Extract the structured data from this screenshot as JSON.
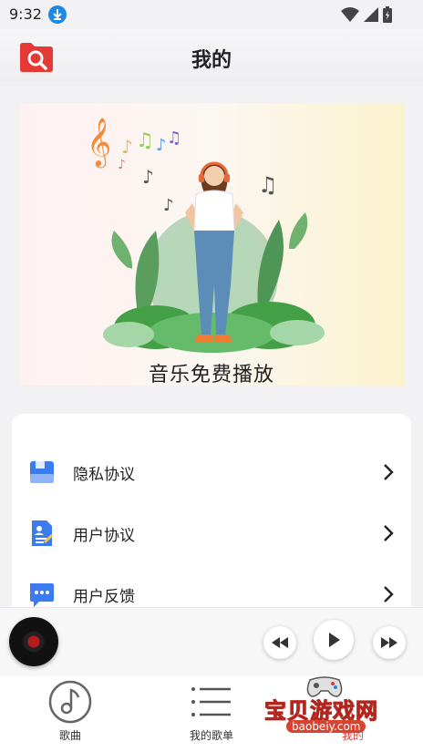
{
  "status_bar": {
    "time": "9:32"
  },
  "header": {
    "title": "我的"
  },
  "banner": {
    "caption": "音乐免费播放"
  },
  "menu": [
    {
      "label": "隐私协议",
      "icon": "privacy-icon"
    },
    {
      "label": "用户协议",
      "icon": "agreement-document-icon"
    },
    {
      "label": "用户反馈",
      "icon": "feedback-chat-icon"
    }
  ],
  "tabs": [
    {
      "label": "歌曲",
      "icon": "music-note-icon"
    },
    {
      "label": "我的歌单",
      "icon": "playlist-icon"
    },
    {
      "label": "我的",
      "icon": "profile-icon"
    }
  ],
  "watermark": {
    "text": "宝贝游戏网",
    "url": "baobeiy.com"
  },
  "colors": {
    "accent": "#e53935",
    "menu_icon_blue": "#3b7bf0",
    "banner_gradient": [
      "#fff1f2",
      "#fbf2cd"
    ]
  }
}
